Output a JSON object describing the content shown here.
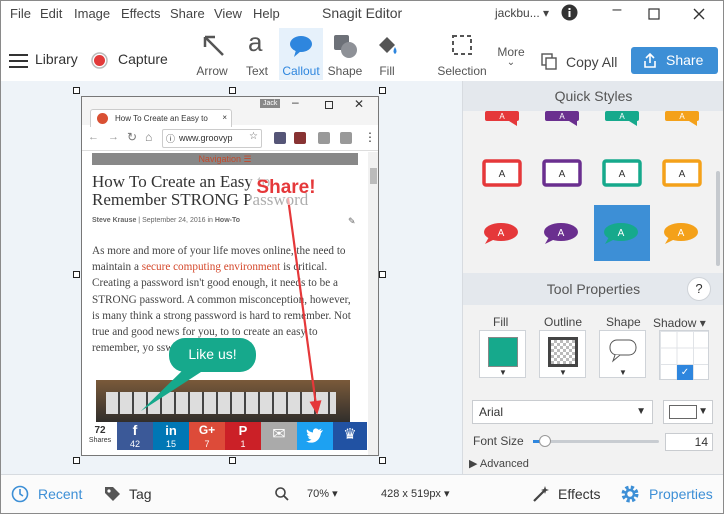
{
  "menu": [
    "File",
    "Edit",
    "Image",
    "Effects",
    "Share",
    "View",
    "Help"
  ],
  "app_title": "Snagit Editor",
  "user": "jackbu...",
  "toolbar": {
    "library": "Library",
    "capture": "Capture",
    "tools": [
      {
        "label": "Arrow"
      },
      {
        "label": "Text"
      },
      {
        "label": "Callout"
      },
      {
        "label": "Shape"
      },
      {
        "label": "Fill"
      },
      {
        "label": "Selection"
      }
    ],
    "more": "More",
    "copy_all": "Copy All",
    "share": "Share"
  },
  "right_panel": {
    "quick_styles": "Quick Styles",
    "style_letter": "A",
    "tool_properties": "Tool Properties",
    "help": "?",
    "fill": "Fill",
    "outline": "Outline",
    "shape": "Shape",
    "shadow": "Shadow",
    "font": "Arial",
    "font_size_label": "Font Size",
    "font_size": "14",
    "advanced": "Advanced"
  },
  "browser": {
    "tab": "How To Create an Easy to",
    "jack": "Jack",
    "url": "www.groovyp",
    "nav": "Navigation",
    "heading": "How To Create an Easy to Remember STRONG Password",
    "author": "Steve Krause",
    "date": "September 24, 2016",
    "in": "in",
    "category": "How-To",
    "body1": "As more and more of your life moves online, the need to maintain a",
    "link": "secure computing environment",
    "body2": "is critical. Creating a password isn't good enough, it needs to be a STRONG password. A common misconception, however, is many think a strong password is hard to remember. Not true and good news for you, to",
    "body3": "to create an easy to remember, yo",
    "body4": "sswords.",
    "callout_share": "Share!",
    "callout_like": "Like us!",
    "shares_count": "72",
    "shares_label": "Shares",
    "buttons": [
      {
        "icon": "f",
        "count": "42",
        "color": "#3b5998"
      },
      {
        "icon": "in",
        "count": "15",
        "color": "#0077b5"
      },
      {
        "icon": "G+",
        "count": "7",
        "color": "#dd4b39"
      },
      {
        "icon": "P",
        "count": "1",
        "color": "#cb2027"
      },
      {
        "icon": "✉",
        "count": "",
        "color": "#aaaaaa"
      },
      {
        "icon": "t",
        "count": "",
        "color": "#1da1f2"
      },
      {
        "icon": "♛",
        "count": "",
        "color": "#2152a3"
      }
    ]
  },
  "bottom": {
    "recent": "Recent",
    "tag": "Tag",
    "zoom": "70%",
    "size": "428 x 519px",
    "effects": "Effects",
    "properties": "Properties"
  },
  "colors": {
    "accent": "#3d8fd6",
    "callout_teal": "#16a98c",
    "share_red": "#e5383a"
  }
}
